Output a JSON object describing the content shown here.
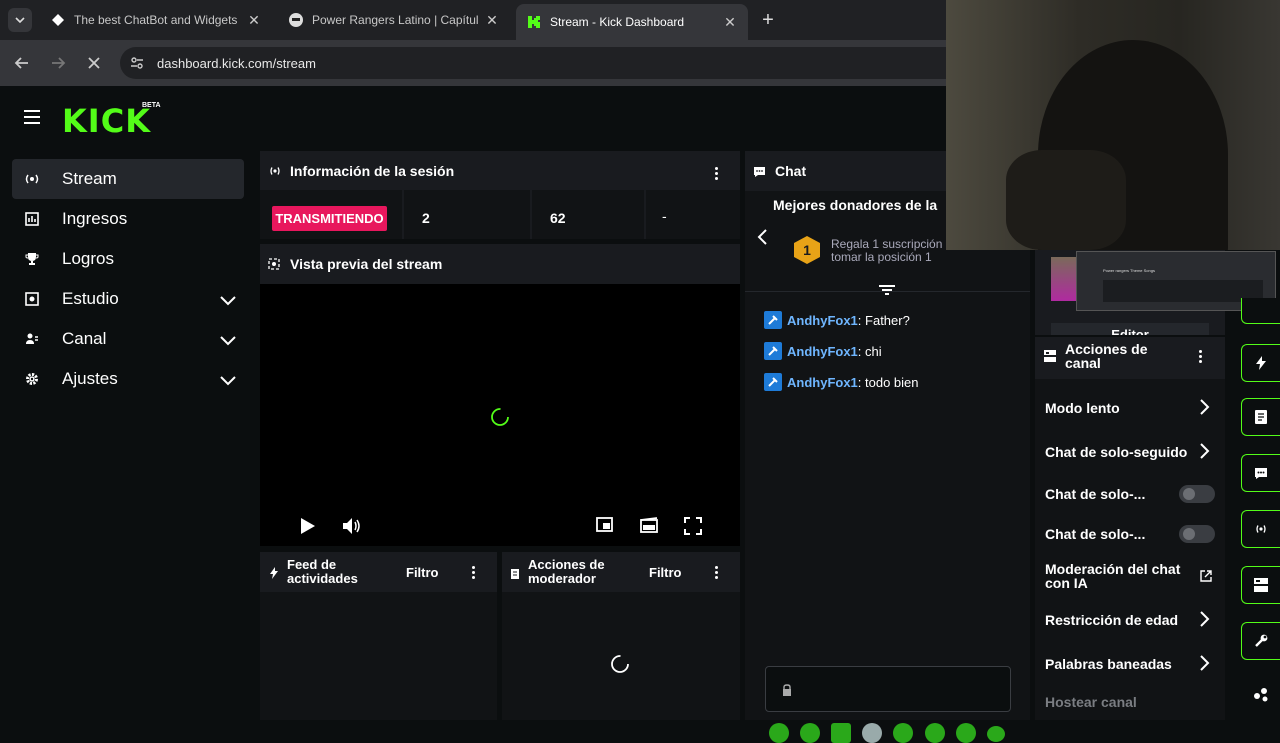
{
  "browser": {
    "tabs": [
      {
        "title": "The best ChatBot and Widgets f",
        "active": false
      },
      {
        "title": "Power Rangers Latino | Capítulo",
        "active": false
      },
      {
        "title": "Stream - Kick Dashboard",
        "active": true
      }
    ],
    "url": "dashboard.kick.com/stream"
  },
  "brand": {
    "logo": "KICK",
    "beta": "BETA",
    "accent": "#53fc18"
  },
  "sidebar": {
    "items": [
      {
        "label": "Stream",
        "icon": "broadcast-icon",
        "active": true
      },
      {
        "label": "Ingresos",
        "icon": "chart-icon"
      },
      {
        "label": "Logros",
        "icon": "trophy-icon"
      },
      {
        "label": "Estudio",
        "icon": "studio-icon",
        "expandable": true
      },
      {
        "label": "Canal",
        "icon": "users-icon",
        "expandable": true
      },
      {
        "label": "Ajustes",
        "icon": "gear-icon",
        "expandable": true
      }
    ]
  },
  "session": {
    "title": "Información de la sesión",
    "status": "TRANSMITIENDO",
    "stat1": "2",
    "stat2": "62",
    "stat3": "-"
  },
  "preview": {
    "title": "Vista previa del stream"
  },
  "activity_feed": {
    "title_line1": "Feed de",
    "title_line2": "actividades",
    "filter": "Filtro"
  },
  "mod_actions": {
    "title_line1": "Acciones de",
    "title_line2": "moderador",
    "filter": "Filtro"
  },
  "chat": {
    "title": "Chat",
    "top_donors": "Mejores donadores de la",
    "gift_line1": "Regala 1 suscripción",
    "gift_line2": "tomar la posición 1",
    "rank": "1",
    "messages": [
      {
        "user": "AndhyFox1",
        "text": ": Father?"
      },
      {
        "user": "AndhyFox1",
        "text": ": chi"
      },
      {
        "user": "AndhyFox1",
        "text": ": todo bien"
      }
    ]
  },
  "channel_actions": {
    "title_line1": "Acciones de",
    "title_line2": "canal",
    "editor": "Editor",
    "items": {
      "slow": "Modo lento",
      "followers": "Chat de solo-seguido",
      "sub1": "Chat de solo-...",
      "sub2": "Chat de solo-...",
      "ai_line1": "Moderación del chat",
      "ai_line2": "con IA",
      "age": "Restricción de edad",
      "banned": "Palabras baneadas",
      "host": "Hostear canal"
    }
  },
  "thumbnail": {
    "text": "Power rangers Theme Songs"
  }
}
